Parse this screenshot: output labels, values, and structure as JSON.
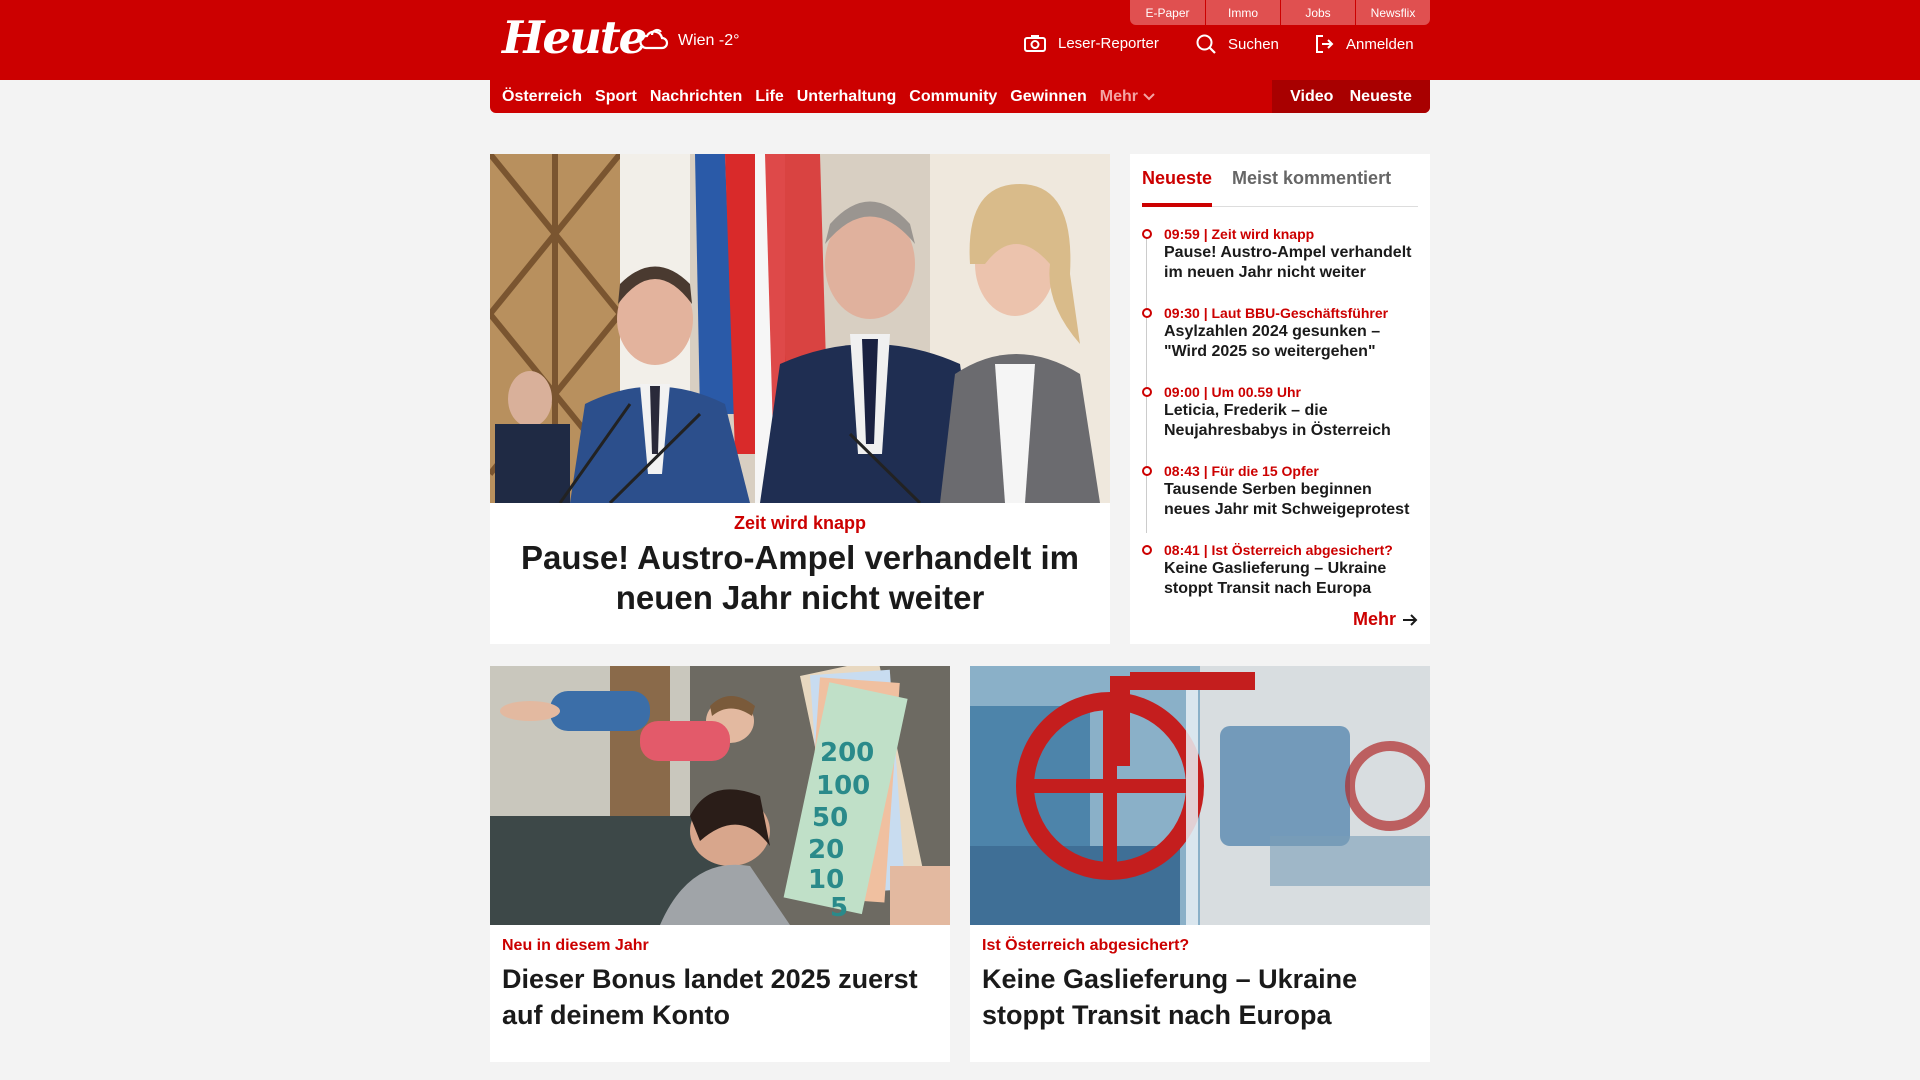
{
  "header": {
    "logo": "Heute",
    "weather": "Wien -2°",
    "topbar": [
      "E-Paper",
      "Immo",
      "Jobs",
      "Newsflix"
    ],
    "leser_reporter": "Leser-Reporter",
    "search": "Suchen",
    "login": "Anmelden"
  },
  "nav": {
    "items": [
      "Österreich",
      "Sport",
      "Nachrichten",
      "Life",
      "Unterhaltung",
      "Community",
      "Gewinnen"
    ],
    "more": "Mehr",
    "video": "Video",
    "neueste": "Neueste"
  },
  "hero": {
    "kicker": "Zeit wird knapp",
    "title": "Pause! Austro-Ampel verhandelt im neuen Jahr nicht weiter"
  },
  "sidebar": {
    "tabs": [
      "Neueste",
      "Meist kommentiert"
    ],
    "items": [
      {
        "meta": "09:59 | Zeit wird knapp",
        "title": "Pause! Austro-Ampel verhandelt im neuen Jahr nicht weiter"
      },
      {
        "meta": "09:30 | Laut BBU-Geschäftsführer",
        "title": "Asylzahlen 2024 gesunken – \"Wird 2025 so weitergehen\""
      },
      {
        "meta": "09:00 | Um 00.59 Uhr",
        "title": "Leticia, Frederik – die Neujahresbabys in Österreich"
      },
      {
        "meta": "08:43 | Für die 15 Opfer",
        "title": "Tausende Serben beginnen neues Jahr mit Schweigeprotest"
      },
      {
        "meta": "08:41 | Ist Österreich abgesichert?",
        "title": "Keine Gaslieferung – Ukraine stoppt Transit nach Europa"
      }
    ],
    "more": "Mehr"
  },
  "cards": [
    {
      "kicker": "Neu in diesem Jahr",
      "title": "Dieser Bonus landet 2025 zuerst auf deinem Konto"
    },
    {
      "kicker": "Ist Österreich abgesichert?",
      "title": "Keine Gaslieferung – Ukraine stoppt Transit nach Europa"
    }
  ],
  "colors": {
    "brand": "#cc0000",
    "background": "#f3f3f3"
  }
}
